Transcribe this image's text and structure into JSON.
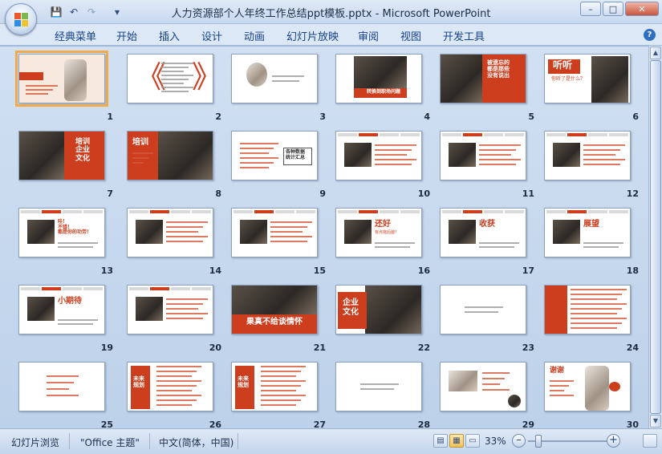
{
  "window": {
    "title": "人力资源部个人年终工作总结ppt模板.pptx - Microsoft PowerPoint",
    "controls": {
      "minimize": "–",
      "maximize": "□",
      "close": "✕"
    }
  },
  "quick_access": {
    "save": "💾",
    "undo": "↶",
    "redo": "↷",
    "customize": "▾"
  },
  "ribbon": {
    "tabs": [
      {
        "label": "经典菜单"
      },
      {
        "label": "开始"
      },
      {
        "label": "插入"
      },
      {
        "label": "设计"
      },
      {
        "label": "动画"
      },
      {
        "label": "幻灯片放映"
      },
      {
        "label": "审阅"
      },
      {
        "label": "视图"
      },
      {
        "label": "开发工具"
      }
    ],
    "help": "?"
  },
  "slides": [
    {
      "num": "1",
      "style": "cover",
      "texts": []
    },
    {
      "num": "2",
      "style": "contents",
      "texts": []
    },
    {
      "num": "3",
      "style": "face-text",
      "texts": []
    },
    {
      "num": "4",
      "style": "photo-caption",
      "texts": [
        "转换到职场问题"
      ]
    },
    {
      "num": "5",
      "style": "photo-red-right",
      "texts": [
        "被遗忘的\n都是那些\n没有说出"
      ]
    },
    {
      "num": "6",
      "style": "listen",
      "texts": [
        "听听",
        "你听了是什么？"
      ]
    },
    {
      "num": "7",
      "style": "photo-red-title",
      "texts": [
        "培训\n企业\n文化"
      ]
    },
    {
      "num": "8",
      "style": "red-left-photo",
      "texts": [
        "培训"
      ]
    },
    {
      "num": "9",
      "style": "list-box",
      "texts": [
        "各种数据\n统计汇总"
      ]
    },
    {
      "num": "10",
      "style": "nav-photo",
      "texts": []
    },
    {
      "num": "11",
      "style": "nav-photo",
      "texts": []
    },
    {
      "num": "12",
      "style": "nav-photo",
      "texts": []
    },
    {
      "num": "13",
      "style": "nav-photo-red",
      "texts": [
        "哇！\n不错！\n都是你的功劳！"
      ]
    },
    {
      "num": "14",
      "style": "nav-photo",
      "texts": []
    },
    {
      "num": "15",
      "style": "nav-photo",
      "texts": []
    },
    {
      "num": "16",
      "style": "nav-photo-red",
      "texts": [
        "还好",
        "有点拖后腿！"
      ]
    },
    {
      "num": "17",
      "style": "nav-photo-red",
      "texts": [
        "收获"
      ]
    },
    {
      "num": "18",
      "style": "nav-photo-red",
      "texts": [
        "展望"
      ]
    },
    {
      "num": "19",
      "style": "nav-photo-red",
      "texts": [
        "小期待"
      ]
    },
    {
      "num": "20",
      "style": "nav-photo",
      "texts": []
    },
    {
      "num": "21",
      "style": "photo-caption-wide",
      "texts": [
        "果真不给谈情怀"
      ]
    },
    {
      "num": "22",
      "style": "red-box-photo",
      "texts": [
        "企业\n文化"
      ]
    },
    {
      "num": "23",
      "style": "text-only",
      "texts": []
    },
    {
      "num": "24",
      "style": "red-left-list",
      "texts": []
    },
    {
      "num": "25",
      "style": "center-red-text",
      "texts": []
    },
    {
      "num": "26",
      "style": "red-left-box",
      "texts": [
        "未来\n规划"
      ]
    },
    {
      "num": "27",
      "style": "red-left-box",
      "texts": [
        "未来\n规划"
      ]
    },
    {
      "num": "28",
      "style": "text-only",
      "texts": []
    },
    {
      "num": "29",
      "style": "photo-red-text",
      "texts": []
    },
    {
      "num": "30",
      "style": "ending",
      "texts": [
        "谢谢"
      ]
    }
  ],
  "statusbar": {
    "view": "幻灯片浏览",
    "theme": "\"Office 主题\"",
    "language": "中文(简体，中国)",
    "zoom": "33%",
    "zoom_fraction": 0.33,
    "zoom_minus": "–",
    "zoom_plus": "+"
  },
  "colors": {
    "accent": "#cc3e1e",
    "ribbon_text": "#15428b"
  }
}
